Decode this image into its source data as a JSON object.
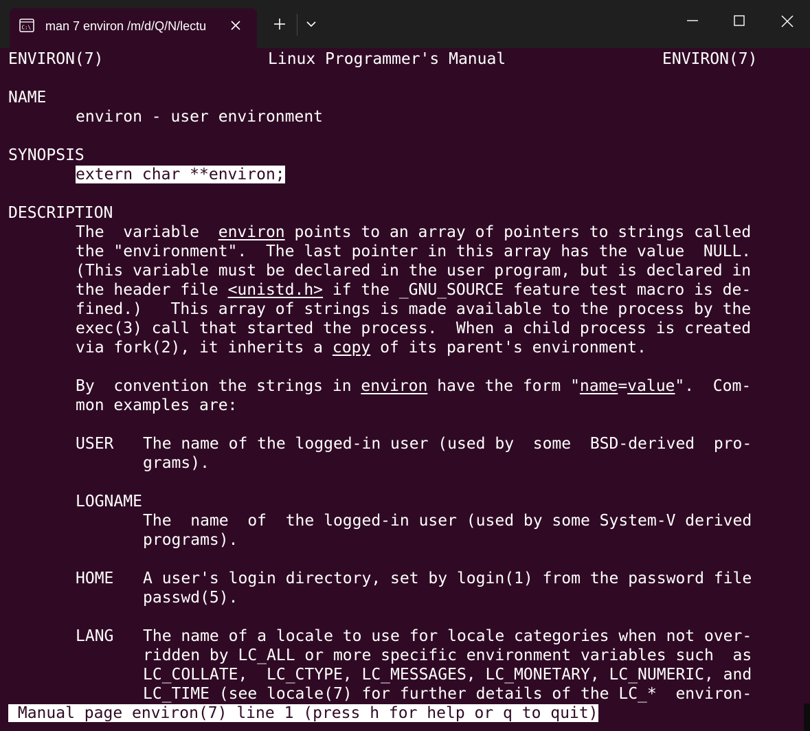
{
  "window": {
    "tab_title": "man 7 environ /m/d/Q/N/lectu",
    "tab_icon": "terminal-icon",
    "buttons": {
      "new_tab": "plus-icon",
      "dropdown": "chevron-down-icon",
      "minimize": "minimize-icon",
      "maximize": "maximize-icon",
      "close": "close-icon"
    }
  },
  "colors": {
    "terminal_bg": "#300a24",
    "titlebar_bg": "#1f1f1f",
    "text": "#ffffff"
  },
  "man": {
    "header": {
      "left": "ENVIRON(7)",
      "center": "Linux Programmer's Manual",
      "right": "ENVIRON(7)"
    },
    "name_heading": "NAME",
    "name_text": "environ - user environment",
    "synopsis_heading": "SYNOPSIS",
    "synopsis_text": "extern char **environ;",
    "description_heading": "DESCRIPTION",
    "desc": {
      "l1a": "The  variable  ",
      "l1u": "environ",
      "l1b": " points to an array of pointers to strings called",
      "l2": "the \"environment\".  The last pointer in this array has the value  NULL.",
      "l3": "(This variable must be declared in the user program, but is declared in",
      "l4a": "the header file ",
      "l4u": "<unistd.h>",
      "l4b": " if the _GNU_SOURCE feature test macro is de-",
      "l5": "fined.)   This array of strings is made available to the process by the",
      "l6": "exec(3) call that started the process.  When a child process is created",
      "l7a": "via fork(2), it inherits a ",
      "l7u": "copy",
      "l7b": " of its parent's environment.",
      "p2a": "By  convention the strings in ",
      "p2u1": "environ",
      "p2b": " have the form \"",
      "p2u2": "name",
      "p2c": "=",
      "p2u3": "value",
      "p2d": "\".  Com-",
      "p2l2": "mon examples are:"
    },
    "user": {
      "name": "USER",
      "l1": "The name of the logged-in user (used by  some  BSD-derived  pro-",
      "l2": "grams)."
    },
    "logname": {
      "name": "LOGNAME",
      "l1": "The  name  of  the logged-in user (used by some System-V derived",
      "l2": "programs)."
    },
    "home": {
      "name": "HOME",
      "l1": "A user's login directory, set by login(1) from the password file",
      "l2": "passwd(5)."
    },
    "lang": {
      "name": "LANG",
      "l1": "The name of a locale to use for locale categories when not over-",
      "l2": "ridden by LC_ALL or more specific environment variables such  as",
      "l3": "LC_COLLATE,  LC_CTYPE, LC_MESSAGES, LC_MONETARY, LC_NUMERIC, and",
      "l4": "LC_TIME (see locale(7) for further details of the LC_*  environ-"
    },
    "status": " Manual page environ(7) line 1 (press h for help or q to quit)"
  }
}
